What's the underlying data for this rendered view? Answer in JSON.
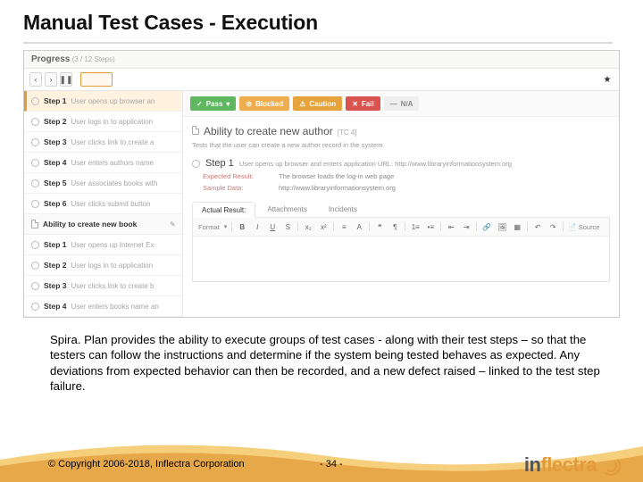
{
  "slide": {
    "title": "Manual Test Cases - Execution",
    "description": "Spira. Plan provides the ability to execute groups of test cases - along with their test steps – so that the testers can follow the instructions and determine if the system being tested behaves as expected. Any deviations from expected behavior can then be recorded, and a new defect raised – linked to the test step failure.",
    "copyright": "© Copyright 2006-2018, Inflectra Corporation",
    "page": "- 34 -",
    "brand_left": "in",
    "brand_right": "flectra"
  },
  "app": {
    "progress_label": "Progress",
    "progress_sub": "(3 / 12 Steps)",
    "nav": {
      "prev": "‹",
      "next": "›",
      "pause": "❚❚"
    },
    "sidebar": {
      "steps_a": [
        {
          "label": "Step 1",
          "desc": "User opens up browser an"
        },
        {
          "label": "Step 2",
          "desc": "User logs in to application"
        },
        {
          "label": "Step 3",
          "desc": "User clicks link to create a"
        },
        {
          "label": "Step 4",
          "desc": "User enters authors name"
        },
        {
          "label": "Step 5",
          "desc": "User associates books with"
        },
        {
          "label": "Step 6",
          "desc": "User clicks submit button"
        }
      ],
      "group": "Ability to create new book",
      "steps_b": [
        {
          "label": "Step 1",
          "desc": "User opens up Internet Ex"
        },
        {
          "label": "Step 2",
          "desc": "User logs in to application"
        },
        {
          "label": "Step 3",
          "desc": "User clicks link to create b"
        },
        {
          "label": "Step 4",
          "desc": "User enters books name an"
        }
      ]
    },
    "status": {
      "pass": "Pass",
      "blocked": "Blocked",
      "caution": "Caution",
      "fail": "Fail",
      "na": "N/A"
    },
    "testcase": {
      "name": "Ability to create new author",
      "id": "[TC 4]",
      "desc": "Tests that the user can create a new author record in the system."
    },
    "currentstep": {
      "name": "Step 1",
      "desc": "User opens up browser and enters application URL: http://www.libraryinformationsystem.org",
      "expected_k": "Expected Result:",
      "expected_v": "The browser loads the log-in web page",
      "sample_k": "Sample Data:",
      "sample_v": "http://www.libraryinformationsystem.org"
    },
    "tabs": {
      "result": "Actual Result:",
      "attach": "Attachments",
      "incidents": "Incidents"
    },
    "editor": {
      "format": "Format",
      "source": "Source"
    }
  }
}
